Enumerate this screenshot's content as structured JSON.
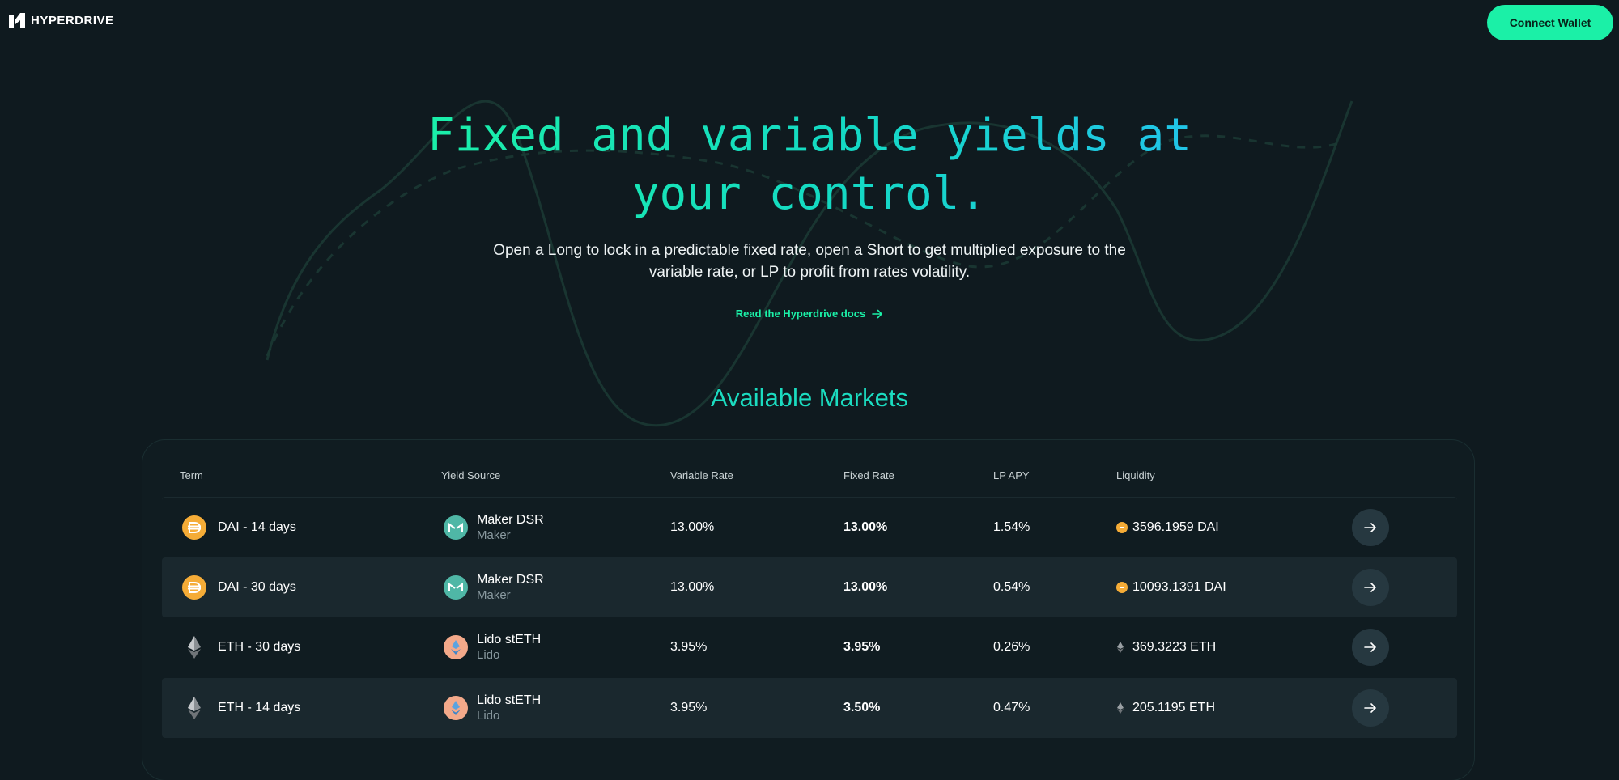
{
  "header": {
    "logo_text": "HYPERDRIVE",
    "connect_label": "Connect Wallet"
  },
  "hero": {
    "title_line1": "Fixed and variable yields at",
    "title_line2": "your control.",
    "subtitle_line1": "Open a Long to lock in a predictable fixed rate, open a Short to get multiplied exposure to the",
    "subtitle_line2": "variable rate, or LP to profit from rates volatility.",
    "docs_link": "Read the Hyperdrive docs"
  },
  "markets": {
    "title": "Available Markets",
    "columns": [
      "Term",
      "Yield Source",
      "Variable Rate",
      "Fixed Rate",
      "LP APY",
      "Liquidity"
    ],
    "rows": [
      {
        "term": "DAI - 14 days",
        "token_icon": "dai-icon",
        "source": "Maker DSR",
        "protocol": "Maker",
        "source_icon": "maker-icon",
        "variable": "13.00%",
        "fixed": "13.00%",
        "lp_apy": "1.54%",
        "liquidity": "3596.1959 DAI",
        "liq_icon": "dai-icon"
      },
      {
        "term": "DAI - 30 days",
        "token_icon": "dai-icon",
        "source": "Maker DSR",
        "protocol": "Maker",
        "source_icon": "maker-icon",
        "variable": "13.00%",
        "fixed": "13.00%",
        "lp_apy": "0.54%",
        "liquidity": "10093.1391 DAI",
        "liq_icon": "dai-icon"
      },
      {
        "term": "ETH - 30 days",
        "token_icon": "eth-icon",
        "source": "Lido stETH",
        "protocol": "Lido",
        "source_icon": "lido-icon",
        "variable": "3.95%",
        "fixed": "3.95%",
        "lp_apy": "0.26%",
        "liquidity": "369.3223 ETH",
        "liq_icon": "eth-icon"
      },
      {
        "term": "ETH - 14 days",
        "token_icon": "eth-icon",
        "source": "Lido stETH",
        "protocol": "Lido",
        "source_icon": "lido-icon",
        "variable": "3.95%",
        "fixed": "3.50%",
        "lp_apy": "0.47%",
        "liquidity": "205.1195 ETH",
        "liq_icon": "eth-icon"
      }
    ]
  },
  "colors": {
    "background": "#0f1a1f",
    "accent": "#1bf0a7",
    "title_gradient_end": "#22c3ea",
    "row_alt": "#1a282e"
  }
}
